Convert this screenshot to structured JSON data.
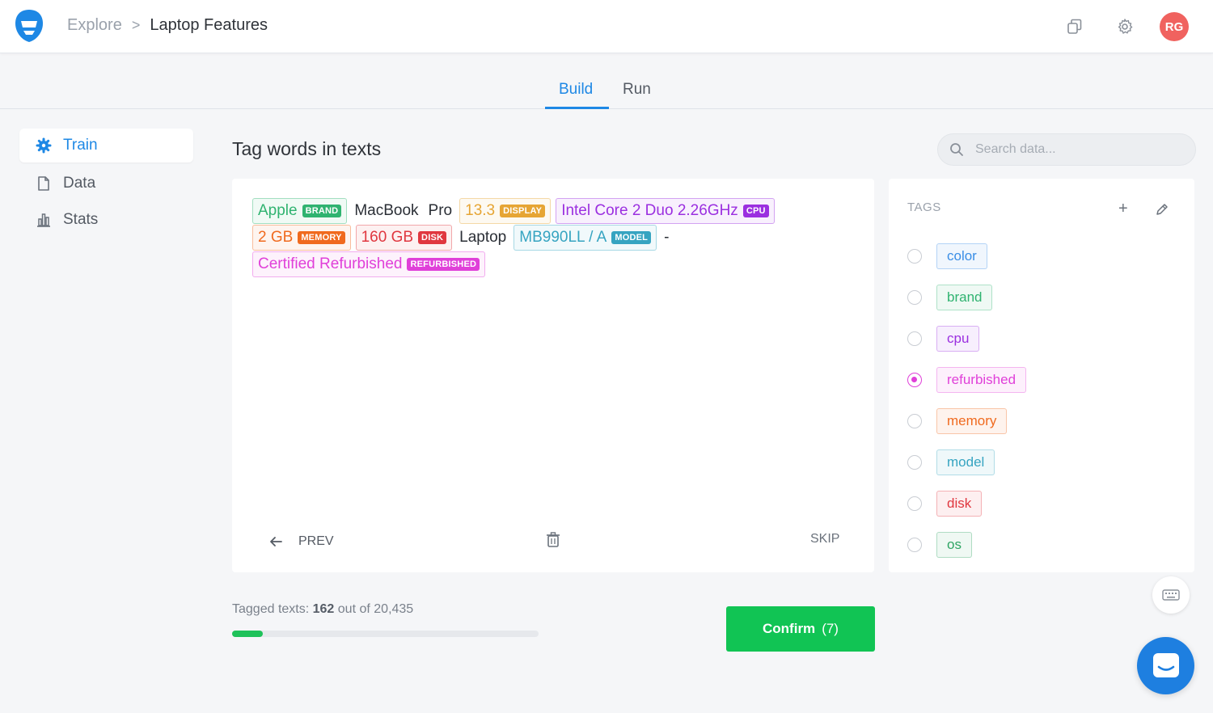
{
  "header": {
    "breadcrumb_root": "Explore",
    "breadcrumb_sep": ">",
    "breadcrumb_current": "Laptop Features",
    "avatar_initials": "RG",
    "icons": [
      "logo-icon",
      "copy-icon",
      "gear-icon"
    ]
  },
  "tabs": {
    "build": "Build",
    "run": "Run",
    "active": "Build"
  },
  "sidebar": {
    "items": [
      {
        "label": "Train",
        "icon": "gear-icon",
        "active": true
      },
      {
        "label": "Data",
        "icon": "file-icon",
        "active": false
      },
      {
        "label": "Stats",
        "icon": "bar-chart-icon",
        "active": false
      }
    ]
  },
  "main": {
    "title": "Tag words in texts",
    "search_placeholder": "Search data..."
  },
  "text": {
    "tokens": [
      {
        "text": "Apple",
        "tag": "BRAND"
      },
      {
        "text": "MacBook"
      },
      {
        "text": "Pro"
      },
      {
        "text": "13.3",
        "tag": "DISPLAY"
      },
      {
        "text": "Intel Core 2 Duo 2.26GHz",
        "tag": "CPU"
      },
      {
        "text": "2 GB",
        "tag": "MEMORY"
      },
      {
        "text": "160 GB",
        "tag": "DISK"
      },
      {
        "text": "Laptop"
      },
      {
        "text": "MB990LL / A",
        "tag": "MODEL"
      },
      {
        "text": "-"
      },
      {
        "text": "Certified Refurbished",
        "tag": "REFURBISHED"
      }
    ],
    "prev_label": "PREV",
    "skip_label": "SKIP"
  },
  "tags": {
    "title": "TAGS",
    "plus": "+",
    "items": [
      {
        "name": "color",
        "selected": false
      },
      {
        "name": "brand",
        "selected": false
      },
      {
        "name": "cpu",
        "selected": false
      },
      {
        "name": "refurbished",
        "selected": true
      },
      {
        "name": "memory",
        "selected": false
      },
      {
        "name": "model",
        "selected": false
      },
      {
        "name": "disk",
        "selected": false
      },
      {
        "name": "os",
        "selected": false
      }
    ]
  },
  "colors": {
    "accent": "#1e88e5",
    "confirm": "#11c454",
    "brand": "#2fb370",
    "display": "#e6a534",
    "cpu": "#9b2fe0",
    "memory": "#f06a1e",
    "disk": "#e0373f",
    "model": "#36a4c1",
    "refurbished": "#e040d9",
    "color": "#3a8ee6",
    "os": "#2fa564"
  },
  "footer": {
    "tagged_prefix": "Tagged texts:",
    "tagged_count": "162",
    "tagged_mid": "out of",
    "tagged_total": "20,435",
    "progress_fraction": 0.0079,
    "confirm_label": "Confirm",
    "confirm_count": "(7)"
  }
}
